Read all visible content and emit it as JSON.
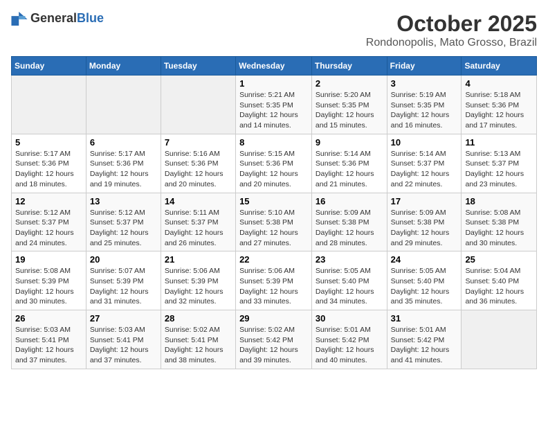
{
  "header": {
    "logo_general": "General",
    "logo_blue": "Blue",
    "title": "October 2025",
    "subtitle": "Rondonopolis, Mato Grosso, Brazil"
  },
  "days_of_week": [
    "Sunday",
    "Monday",
    "Tuesday",
    "Wednesday",
    "Thursday",
    "Friday",
    "Saturday"
  ],
  "weeks": [
    [
      {
        "day": "",
        "info": ""
      },
      {
        "day": "",
        "info": ""
      },
      {
        "day": "",
        "info": ""
      },
      {
        "day": "1",
        "info": "Sunrise: 5:21 AM\nSunset: 5:35 PM\nDaylight: 12 hours\nand 14 minutes."
      },
      {
        "day": "2",
        "info": "Sunrise: 5:20 AM\nSunset: 5:35 PM\nDaylight: 12 hours\nand 15 minutes."
      },
      {
        "day": "3",
        "info": "Sunrise: 5:19 AM\nSunset: 5:35 PM\nDaylight: 12 hours\nand 16 minutes."
      },
      {
        "day": "4",
        "info": "Sunrise: 5:18 AM\nSunset: 5:36 PM\nDaylight: 12 hours\nand 17 minutes."
      }
    ],
    [
      {
        "day": "5",
        "info": "Sunrise: 5:17 AM\nSunset: 5:36 PM\nDaylight: 12 hours\nand 18 minutes."
      },
      {
        "day": "6",
        "info": "Sunrise: 5:17 AM\nSunset: 5:36 PM\nDaylight: 12 hours\nand 19 minutes."
      },
      {
        "day": "7",
        "info": "Sunrise: 5:16 AM\nSunset: 5:36 PM\nDaylight: 12 hours\nand 20 minutes."
      },
      {
        "day": "8",
        "info": "Sunrise: 5:15 AM\nSunset: 5:36 PM\nDaylight: 12 hours\nand 20 minutes."
      },
      {
        "day": "9",
        "info": "Sunrise: 5:14 AM\nSunset: 5:36 PM\nDaylight: 12 hours\nand 21 minutes."
      },
      {
        "day": "10",
        "info": "Sunrise: 5:14 AM\nSunset: 5:37 PM\nDaylight: 12 hours\nand 22 minutes."
      },
      {
        "day": "11",
        "info": "Sunrise: 5:13 AM\nSunset: 5:37 PM\nDaylight: 12 hours\nand 23 minutes."
      }
    ],
    [
      {
        "day": "12",
        "info": "Sunrise: 5:12 AM\nSunset: 5:37 PM\nDaylight: 12 hours\nand 24 minutes."
      },
      {
        "day": "13",
        "info": "Sunrise: 5:12 AM\nSunset: 5:37 PM\nDaylight: 12 hours\nand 25 minutes."
      },
      {
        "day": "14",
        "info": "Sunrise: 5:11 AM\nSunset: 5:37 PM\nDaylight: 12 hours\nand 26 minutes."
      },
      {
        "day": "15",
        "info": "Sunrise: 5:10 AM\nSunset: 5:38 PM\nDaylight: 12 hours\nand 27 minutes."
      },
      {
        "day": "16",
        "info": "Sunrise: 5:09 AM\nSunset: 5:38 PM\nDaylight: 12 hours\nand 28 minutes."
      },
      {
        "day": "17",
        "info": "Sunrise: 5:09 AM\nSunset: 5:38 PM\nDaylight: 12 hours\nand 29 minutes."
      },
      {
        "day": "18",
        "info": "Sunrise: 5:08 AM\nSunset: 5:38 PM\nDaylight: 12 hours\nand 30 minutes."
      }
    ],
    [
      {
        "day": "19",
        "info": "Sunrise: 5:08 AM\nSunset: 5:39 PM\nDaylight: 12 hours\nand 30 minutes."
      },
      {
        "day": "20",
        "info": "Sunrise: 5:07 AM\nSunset: 5:39 PM\nDaylight: 12 hours\nand 31 minutes."
      },
      {
        "day": "21",
        "info": "Sunrise: 5:06 AM\nSunset: 5:39 PM\nDaylight: 12 hours\nand 32 minutes."
      },
      {
        "day": "22",
        "info": "Sunrise: 5:06 AM\nSunset: 5:39 PM\nDaylight: 12 hours\nand 33 minutes."
      },
      {
        "day": "23",
        "info": "Sunrise: 5:05 AM\nSunset: 5:40 PM\nDaylight: 12 hours\nand 34 minutes."
      },
      {
        "day": "24",
        "info": "Sunrise: 5:05 AM\nSunset: 5:40 PM\nDaylight: 12 hours\nand 35 minutes."
      },
      {
        "day": "25",
        "info": "Sunrise: 5:04 AM\nSunset: 5:40 PM\nDaylight: 12 hours\nand 36 minutes."
      }
    ],
    [
      {
        "day": "26",
        "info": "Sunrise: 5:03 AM\nSunset: 5:41 PM\nDaylight: 12 hours\nand 37 minutes."
      },
      {
        "day": "27",
        "info": "Sunrise: 5:03 AM\nSunset: 5:41 PM\nDaylight: 12 hours\nand 37 minutes."
      },
      {
        "day": "28",
        "info": "Sunrise: 5:02 AM\nSunset: 5:41 PM\nDaylight: 12 hours\nand 38 minutes."
      },
      {
        "day": "29",
        "info": "Sunrise: 5:02 AM\nSunset: 5:42 PM\nDaylight: 12 hours\nand 39 minutes."
      },
      {
        "day": "30",
        "info": "Sunrise: 5:01 AM\nSunset: 5:42 PM\nDaylight: 12 hours\nand 40 minutes."
      },
      {
        "day": "31",
        "info": "Sunrise: 5:01 AM\nSunset: 5:42 PM\nDaylight: 12 hours\nand 41 minutes."
      },
      {
        "day": "",
        "info": ""
      }
    ]
  ]
}
